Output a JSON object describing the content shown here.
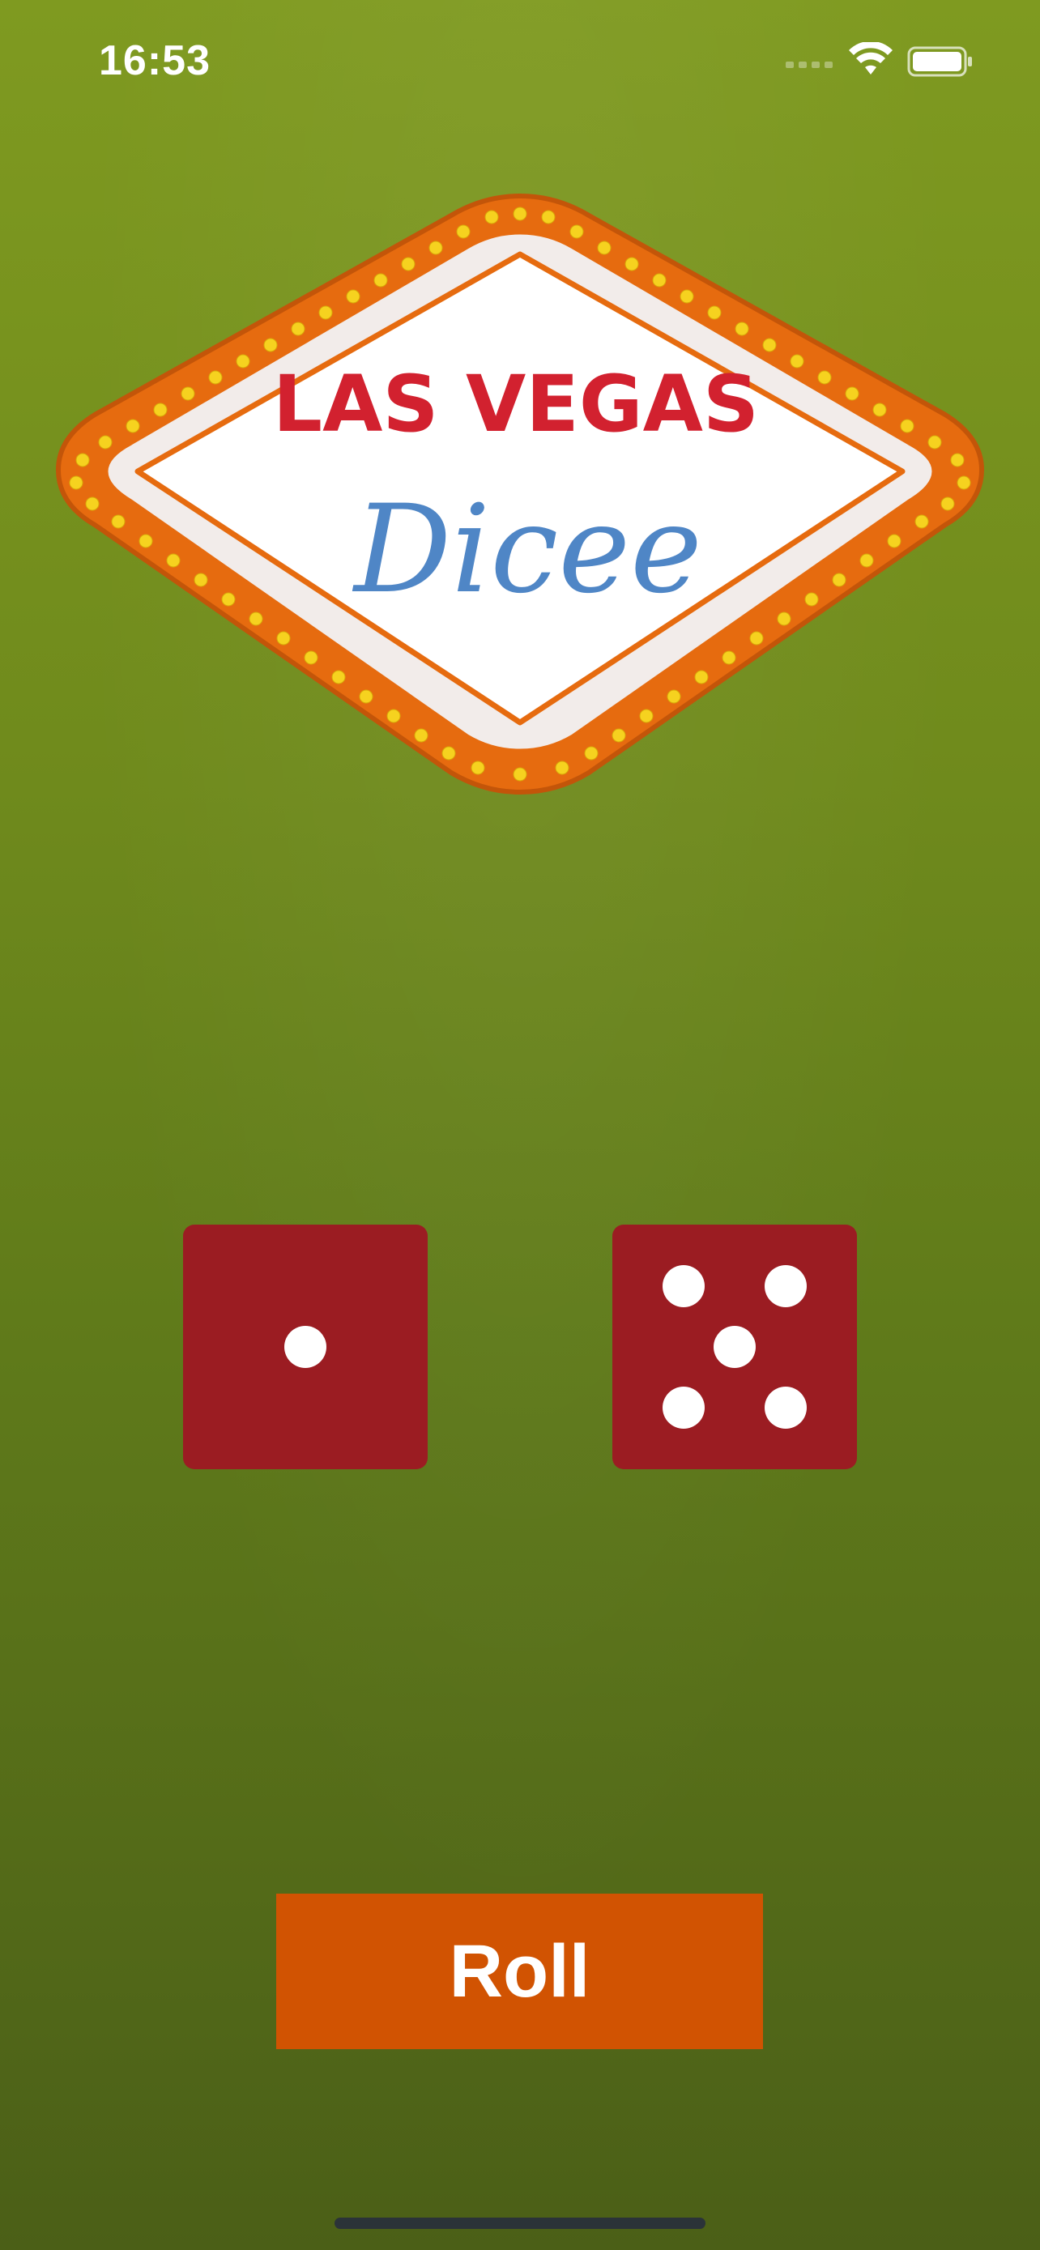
{
  "status_bar": {
    "time": "16:53",
    "icons": [
      "cellular-signal-icon",
      "wifi-icon",
      "battery-icon"
    ]
  },
  "logo": {
    "line1": "LAS VEGAS",
    "line2": "Dicee",
    "colors": {
      "line1": "#d2212f",
      "line2": "#4f86c6",
      "frame_orange": "#e66b0f",
      "bulbs": "#f6d21f"
    }
  },
  "dice": [
    {
      "value": 1
    },
    {
      "value": 5
    }
  ],
  "roll_button": {
    "label": "Roll",
    "color": "#d15302"
  }
}
